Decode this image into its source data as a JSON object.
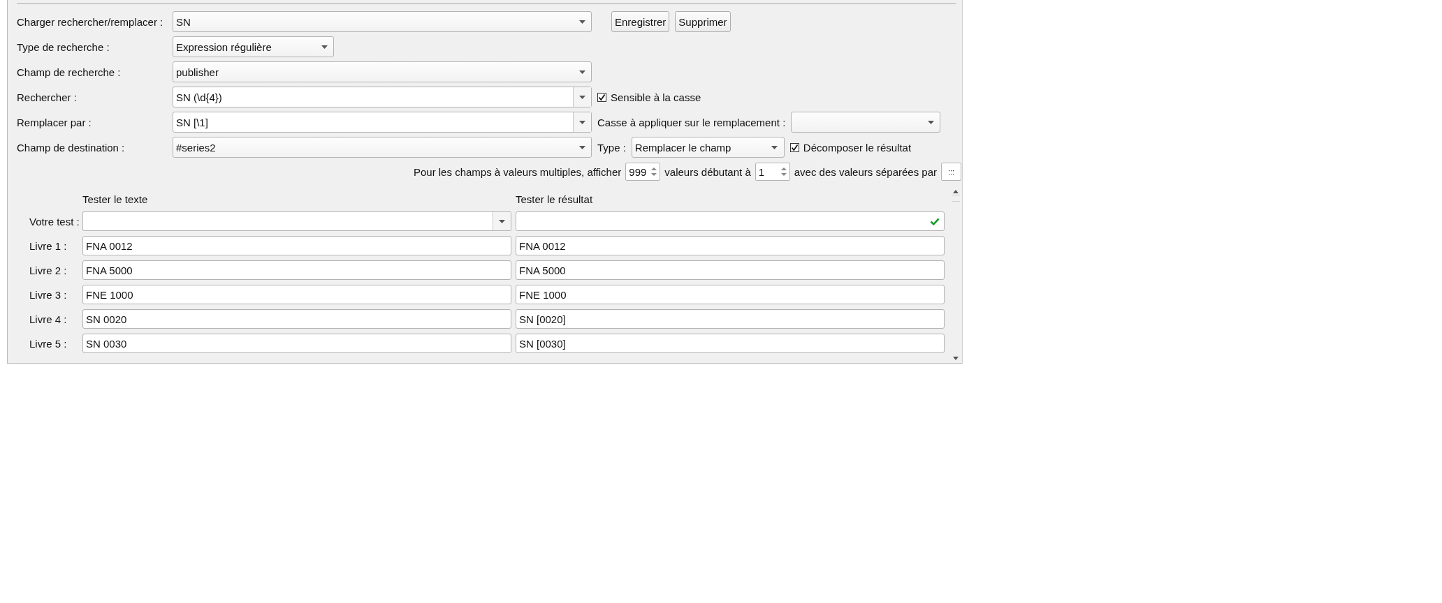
{
  "load": {
    "label": "Charger rechercher/remplacer :",
    "value": "SN"
  },
  "buttons": [
    "Enregistrer",
    "Supprimer"
  ],
  "search_type": {
    "label": "Type de recherche :",
    "value": "Expression régulière"
  },
  "search_field": {
    "label": "Champ de recherche :",
    "value": "publisher"
  },
  "search": {
    "label": "Rechercher :",
    "value": "SN (\\d{4})"
  },
  "case_sensitive": {
    "label": "Sensible à la casse",
    "checked": true
  },
  "replace": {
    "label": "Remplacer par :",
    "value": "SN [\\1]"
  },
  "case_to_apply": {
    "label": "Casse à appliquer sur le remplacement :"
  },
  "destination": {
    "label": "Champ de destination :",
    "value": "#series2"
  },
  "type": {
    "label": "Type :",
    "value": "Remplacer le champ"
  },
  "split_result": {
    "label": "Décomposer le résultat",
    "checked": true
  },
  "multi_values": {
    "text_before": "Pour les champs à valeurs multiples, afficher",
    "show_count": "999",
    "text_mid": "valeurs débutant à",
    "start_at": "1",
    "text_after": "avec des valeurs séparées par",
    "separator": ":::"
  },
  "test": {
    "column_1_header": "Tester le texte",
    "column_2_header": "Tester le résultat",
    "your_test_label": "Votre test :",
    "books": [
      {
        "label": "Livre 1 :",
        "text": "FNA 0012",
        "result": "FNA 0012"
      },
      {
        "label": "Livre 2 :",
        "text": "FNA 5000",
        "result": "FNA 5000"
      },
      {
        "label": "Livre 3 :",
        "text": "FNE 1000",
        "result": "FNE 1000"
      },
      {
        "label": "Livre 4 :",
        "text": "SN 0020",
        "result": "SN [0020]"
      },
      {
        "label": "Livre 5 :",
        "text": "SN 0030",
        "result": "SN [0030]"
      }
    ]
  }
}
